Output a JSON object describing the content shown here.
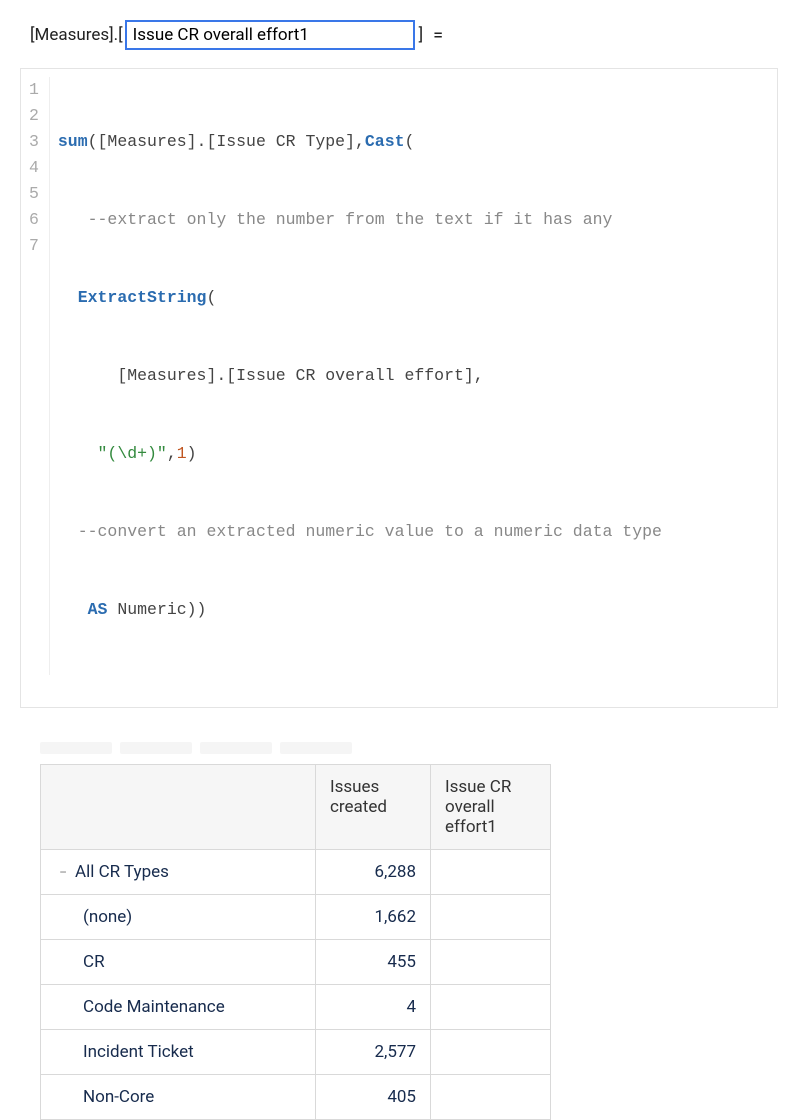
{
  "formula": {
    "prefix": "[Measures].[",
    "input_value": "Issue CR overall effort1",
    "suffix": "]",
    "equals": "="
  },
  "code": {
    "gutter": [
      "1",
      "2",
      "3",
      "4",
      "5",
      "6",
      "7"
    ],
    "line1": {
      "sum": "sum",
      "p1": "(",
      "m1": "[Measures].[Issue CR Type]",
      "comma": ",",
      "cast": "Cast",
      "p2": "("
    },
    "line2": {
      "indent": "   ",
      "comment": "--extract only the number from the text if it has any"
    },
    "line3": {
      "indent": "  ",
      "fn": "ExtractString",
      "p": "("
    },
    "line4": {
      "indent": "      ",
      "m": "[Measures].[Issue CR overall effort]",
      "comma": ","
    },
    "line5": {
      "indent": "    ",
      "str": "\"(\\d+)\"",
      "comma": ",",
      "num": "1",
      "p": ")"
    },
    "line6": {
      "indent": "  ",
      "comment": "--convert an extracted numeric value to a numeric data type"
    },
    "line7": {
      "indent": "   ",
      "as": "AS",
      "sp": " ",
      "type": "Numeric",
      "p": "))"
    }
  },
  "table": {
    "headers": {
      "rowcat": "",
      "issues": "Issues created",
      "effort": "Issue CR overall effort1"
    },
    "rows": [
      {
        "label": "All CR Types",
        "issues": "6,288",
        "effort": "",
        "level": 0,
        "collapsible": true
      },
      {
        "label": "(none)",
        "issues": "1,662",
        "effort": "",
        "level": 1,
        "collapsible": false
      },
      {
        "label": "CR",
        "issues": "455",
        "effort": "",
        "level": 1,
        "collapsible": false
      },
      {
        "label": "Code Maintenance",
        "issues": "4",
        "effort": "",
        "level": 1,
        "collapsible": false
      },
      {
        "label": "Incident Ticket",
        "issues": "2,577",
        "effort": "",
        "level": 1,
        "collapsible": false
      },
      {
        "label": "Non-Core",
        "issues": "405",
        "effort": "",
        "level": 1,
        "collapsible": false
      }
    ]
  }
}
